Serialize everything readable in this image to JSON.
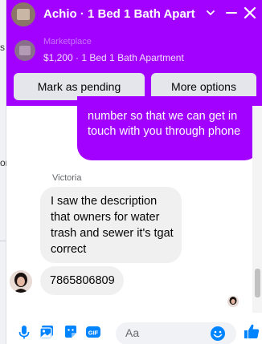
{
  "background": {
    "fragments": [
      "s",
      "or"
    ]
  },
  "header": {
    "title": "Achio · 1 Bed 1 Bath Apart",
    "accent_color": "#a200ff",
    "icons": [
      "chevron-down-icon",
      "minimize-icon",
      "close-icon"
    ]
  },
  "marketplace": {
    "label": "Marketplace",
    "listing": "$1,200 · 1 Bed 1 Bath Apartment"
  },
  "actions": {
    "mark_pending": "Mark as pending",
    "more_options": "More options"
  },
  "messages": {
    "outgoing_text": "number so that we can get in touch with you through phone",
    "sender_name": "Victoria",
    "incoming_1": "I saw the description that owners for water trash and sewer it's tgat correct",
    "incoming_2": "7865806809"
  },
  "composer": {
    "placeholder": "Aa",
    "icons": [
      "microphone-icon",
      "photo-icon",
      "sticker-icon",
      "gif-icon",
      "emoji-icon",
      "thumbs-up-icon"
    ],
    "gif_label": "GIF"
  }
}
